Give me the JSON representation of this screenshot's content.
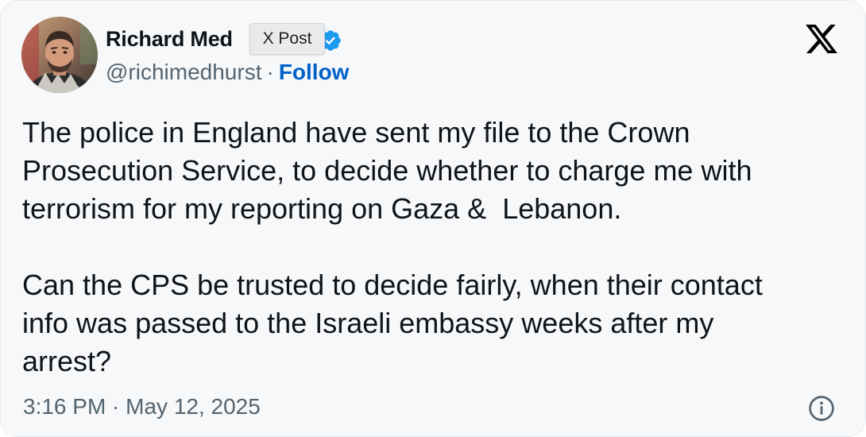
{
  "author": {
    "display_name": "Richard Med",
    "handle": "@richimedhurst",
    "separator": "·",
    "follow_label": "Follow",
    "verified_color": "#1d9bf0",
    "avatar_icon": "profile-photo"
  },
  "tooltip": {
    "label": "X Post"
  },
  "brand": {
    "logo_icon": "x-logo-icon"
  },
  "post": {
    "paragraphs": [
      "The police in England have sent my file to the Crown\nProsecution Service, to decide whether to charge me with\nterrorism for my reporting on Gaza &  Lebanon.",
      "Can the CPS be trusted to decide fairly, when their contact\ninfo was passed to the Israeli embassy weeks after my\narrest?"
    ],
    "timestamp": "3:16 PM · May 12, 2025"
  },
  "actions": {
    "info_icon": "info-icon"
  },
  "colors": {
    "text": "#0f1419",
    "muted": "#536471",
    "link": "#0061c8",
    "background": "#f7f8f9"
  }
}
